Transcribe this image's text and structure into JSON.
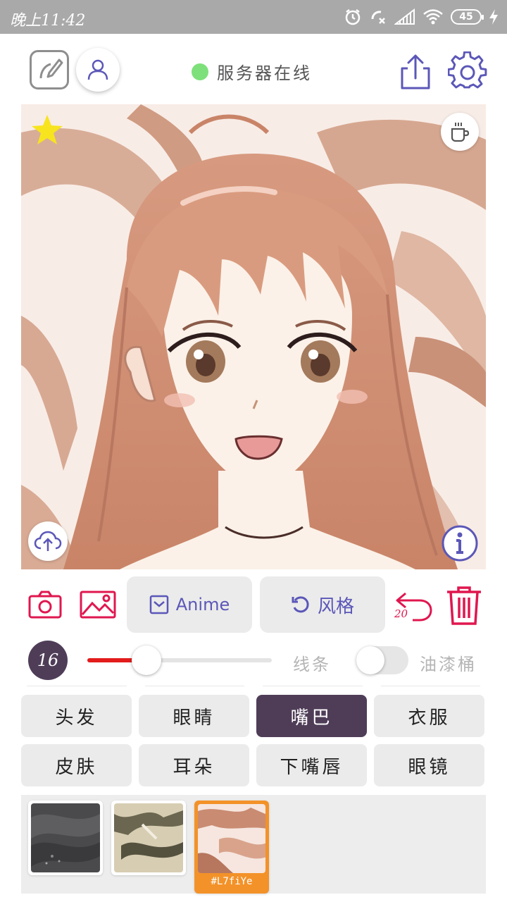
{
  "status_bar": {
    "time": "晚上11:42",
    "battery": "45"
  },
  "header": {
    "server_status": "服务器在线"
  },
  "actions": {
    "mode_label": "Anime",
    "style_label": "风格",
    "undo_count": "20"
  },
  "brush": {
    "size": "16",
    "slider_value": 0.32,
    "line_label": "线条",
    "oil_label": "油漆桶",
    "oil_enabled": false
  },
  "parts": [
    {
      "label": "头发",
      "selected": false
    },
    {
      "label": "眼睛",
      "selected": false
    },
    {
      "label": "嘴巴",
      "selected": true
    },
    {
      "label": "衣服",
      "selected": false
    },
    {
      "label": "皮肤",
      "selected": false
    },
    {
      "label": "耳朵",
      "selected": false
    },
    {
      "label": "下嘴唇",
      "selected": false
    },
    {
      "label": "眼镜",
      "selected": false
    }
  ],
  "swatches": [
    {
      "name": "dark-fabric",
      "active": false
    },
    {
      "name": "olive-pattern",
      "active": false
    },
    {
      "name": "peach-pattern",
      "active": true,
      "caption": "#L7fiYe"
    }
  ],
  "colors": {
    "accent_pink": "#e0174f",
    "accent_indigo": "#5b57b8",
    "selected_purple": "#4f3d58",
    "server_online": "#7ee07a",
    "swatch_active": "#f39229"
  },
  "icons": {
    "editor": "sketch-edit-icon",
    "user": "user-icon",
    "share": "share-icon",
    "settings": "gear-icon",
    "star": "star-icon",
    "coffee": "coffee-cup-icon",
    "upload": "cloud-upload-icon",
    "info": "info-icon",
    "camera": "camera-icon",
    "gallery": "image-icon",
    "mode": "checkbox-icon",
    "style": "refresh-icon",
    "undo": "undo-icon",
    "delete": "trash-icon"
  }
}
